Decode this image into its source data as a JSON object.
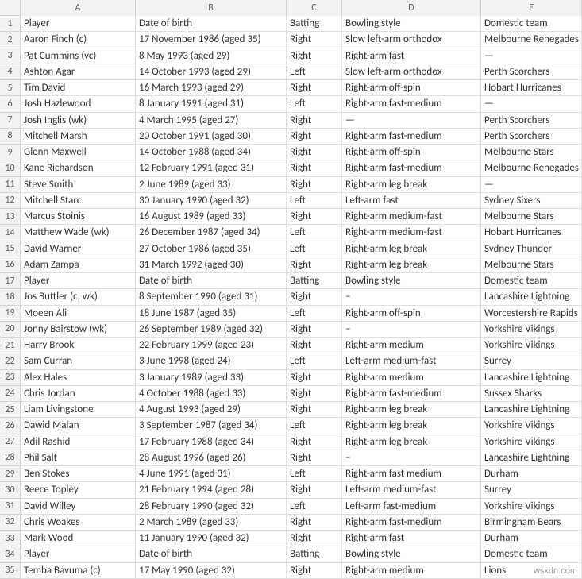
{
  "columns": [
    "A",
    "B",
    "C",
    "D",
    "E"
  ],
  "rowCount": 35,
  "watermark": "wsxdn.com",
  "chart_data": {
    "type": "table",
    "title": "",
    "headers": [
      "Player",
      "Date of birth",
      "Batting",
      "Bowling style",
      "Domestic team"
    ],
    "rows": [
      [
        "Player",
        "Date of birth",
        "Batting",
        "Bowling style",
        "Domestic team"
      ],
      [
        "Aaron Finch (c)",
        "17 November 1986 (aged 35)",
        "Right",
        "Slow left-arm orthodox",
        "Melbourne Renegades"
      ],
      [
        "Pat Cummins (vc)",
        "8 May 1993 (aged 29)",
        "Right",
        "Right-arm fast",
        "—"
      ],
      [
        "Ashton Agar",
        "14 October 1993 (aged 29)",
        "Left",
        "Slow left-arm orthodox",
        "Perth Scorchers"
      ],
      [
        "Tim David",
        "16 March 1993 (aged 29)",
        "Right",
        "Right-arm off-spin",
        "Hobart Hurricanes"
      ],
      [
        "Josh Hazlewood",
        "8 January 1991 (aged 31)",
        "Left",
        "Right-arm fast-medium",
        "—"
      ],
      [
        "Josh Inglis (wk)",
        "4 March 1995 (aged 27)",
        "Right",
        "—",
        "Perth Scorchers"
      ],
      [
        "Mitchell Marsh",
        "20 October 1991 (aged 30)",
        "Right",
        "Right-arm fast-medium",
        "Perth Scorchers"
      ],
      [
        "Glenn Maxwell",
        "14 October 1988 (aged 34)",
        "Right",
        "Right-arm off-spin",
        "Melbourne Stars"
      ],
      [
        "Kane Richardson",
        "12 February 1991 (aged 31)",
        "Right",
        "Right-arm fast-medium",
        "Melbourne Renegades"
      ],
      [
        "Steve Smith",
        "2 June 1989 (aged 33)",
        "Right",
        "Right-arm leg break",
        "—"
      ],
      [
        "Mitchell Starc",
        "30 January 1990 (aged 32)",
        "Left",
        "Left-arm fast",
        "Sydney Sixers"
      ],
      [
        "Marcus Stoinis",
        "16 August 1989 (aged 33)",
        "Right",
        "Right-arm medium-fast",
        "Melbourne Stars"
      ],
      [
        "Matthew Wade (wk)",
        "26 December 1987 (aged 34)",
        "Left",
        "Right-arm medium-fast",
        "Hobart Hurricanes"
      ],
      [
        "David Warner",
        "27 October 1986 (aged 35)",
        "Left",
        "Right-arm leg break",
        "Sydney Thunder"
      ],
      [
        "Adam Zampa",
        "31 March 1992 (aged 30)",
        "Right",
        "Right-arm leg break",
        "Melbourne Stars"
      ],
      [
        "Player",
        "Date of birth",
        "Batting",
        "Bowling style",
        "Domestic team"
      ],
      [
        "Jos Buttler (c, wk)",
        "8 September 1990 (aged 31)",
        "Right",
        "–",
        "Lancashire Lightning"
      ],
      [
        "Moeen Ali",
        "18 June 1987 (aged 35)",
        "Left",
        "Right-arm off-spin",
        "Worcestershire Rapids"
      ],
      [
        "Jonny Bairstow (wk)",
        "26 September 1989 (aged 32)",
        "Right",
        "–",
        "Yorkshire Vikings"
      ],
      [
        "Harry Brook",
        "22 February 1999 (aged 23)",
        "Right",
        "Right-arm medium",
        "Yorkshire Vikings"
      ],
      [
        "Sam Curran",
        "3 June 1998 (aged 24)",
        "Left",
        "Left-arm medium-fast",
        "Surrey"
      ],
      [
        "Alex Hales",
        "3 January 1989 (aged 33)",
        "Right",
        "Right-arm medium",
        "Lancashire Lightning"
      ],
      [
        "Chris Jordan",
        "4 October 1988 (aged 33)",
        "Right",
        "Right-arm fast-medium",
        "Sussex Sharks"
      ],
      [
        "Liam Livingstone",
        "4 August 1993 (aged 29)",
        "Right",
        "Right-arm leg break",
        "Lancashire Lightning"
      ],
      [
        "Dawid Malan",
        "3 September 1987 (aged 34)",
        "Left",
        "Right-arm leg break",
        "Yorkshire Vikings"
      ],
      [
        "Adil Rashid",
        "17 February 1988 (aged 34)",
        "Right",
        "Right-arm leg break",
        "Yorkshire Vikings"
      ],
      [
        "Phil Salt",
        "28 August 1996 (aged 26)",
        "Right",
        "–",
        "Lancashire Lightning"
      ],
      [
        "Ben Stokes",
        "4 June 1991 (aged 31)",
        "Left",
        "Right-arm fast medium",
        "Durham"
      ],
      [
        "Reece Topley",
        "21 February 1994 (aged 28)",
        "Right",
        "Left-arm medium-fast",
        "Surrey"
      ],
      [
        "David Willey",
        "28 February 1990 (aged 32)",
        "Left",
        "Left-arm fast-medium",
        "Yorkshire Vikings"
      ],
      [
        "Chris Woakes",
        "2 March 1989 (aged 33)",
        "Right",
        "Right-arm fast-medium",
        "Birmingham Bears"
      ],
      [
        "Mark Wood",
        "11 January 1990 (aged 32)",
        "Right",
        "Right-arm fast",
        "Durham"
      ],
      [
        "Player",
        "Date of birth",
        "Batting",
        "Bowling style",
        "Domestic team"
      ],
      [
        "Temba Bavuma (c)",
        "17 May 1990 (aged 32)",
        "Right",
        "Right-arm medium",
        "Lions"
      ]
    ]
  }
}
